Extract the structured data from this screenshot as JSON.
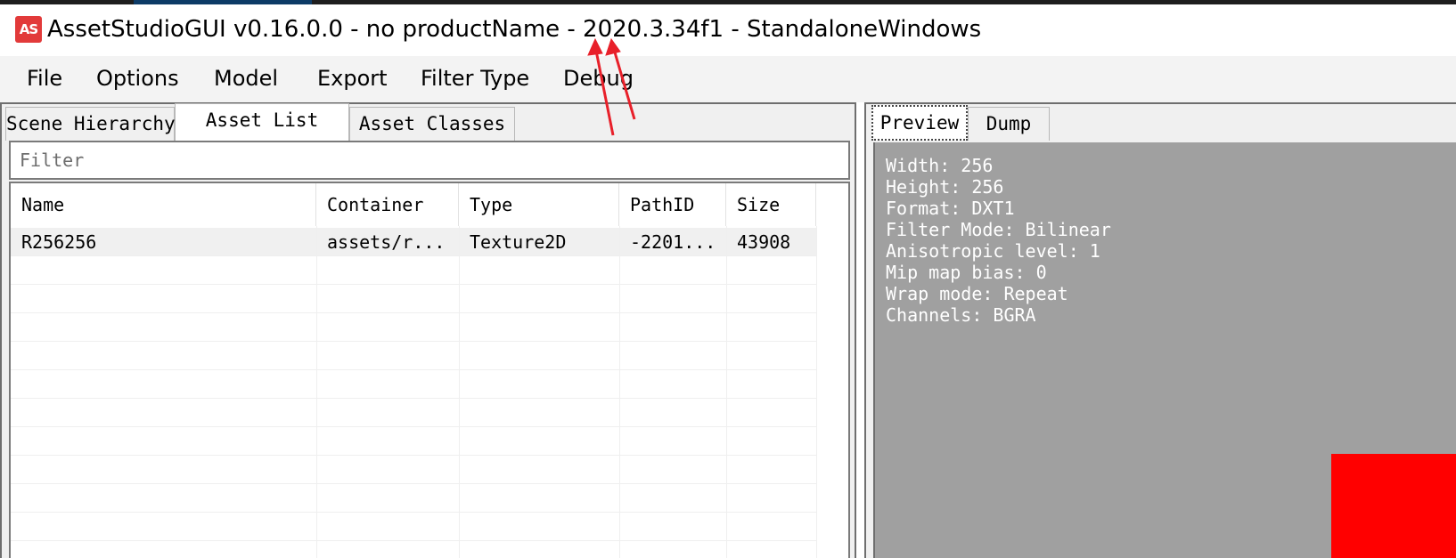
{
  "window": {
    "icon_text": "AS",
    "title": "AssetStudioGUI v0.16.0.0 - no productName - 2020.3.34f1 - StandaloneWindows"
  },
  "menu": [
    "File",
    "Options",
    "Model",
    "Export",
    "Filter Type",
    "Debug"
  ],
  "left_tabs": [
    {
      "label": "Scene Hierarchy",
      "selected": false
    },
    {
      "label": "Asset List",
      "selected": true
    },
    {
      "label": "Asset Classes",
      "selected": false
    }
  ],
  "filter": {
    "placeholder": "Filter",
    "value": ""
  },
  "asset_list": {
    "columns": [
      "Name",
      "Container",
      "Type",
      "PathID",
      "Size"
    ],
    "rows": [
      {
        "name": "R256256",
        "container": "assets/r...",
        "type": "Texture2D",
        "path_id": "-2201...",
        "size": "43908"
      }
    ]
  },
  "right_tabs": [
    {
      "label": "Preview",
      "selected": true
    },
    {
      "label": "Dump",
      "selected": false
    }
  ],
  "preview": {
    "info": [
      "Width: 256",
      "Height: 256",
      "Format: DXT1",
      "Filter Mode: Bilinear",
      "Anisotropic level: 1",
      "Mip map bias: 0",
      "Wrap mode: Repeat",
      "Channels: BGRA"
    ],
    "background_color": "#a0a0a0",
    "texture_color": "#ff0000"
  },
  "annotation": {
    "arrow_color": "#e8202a"
  }
}
